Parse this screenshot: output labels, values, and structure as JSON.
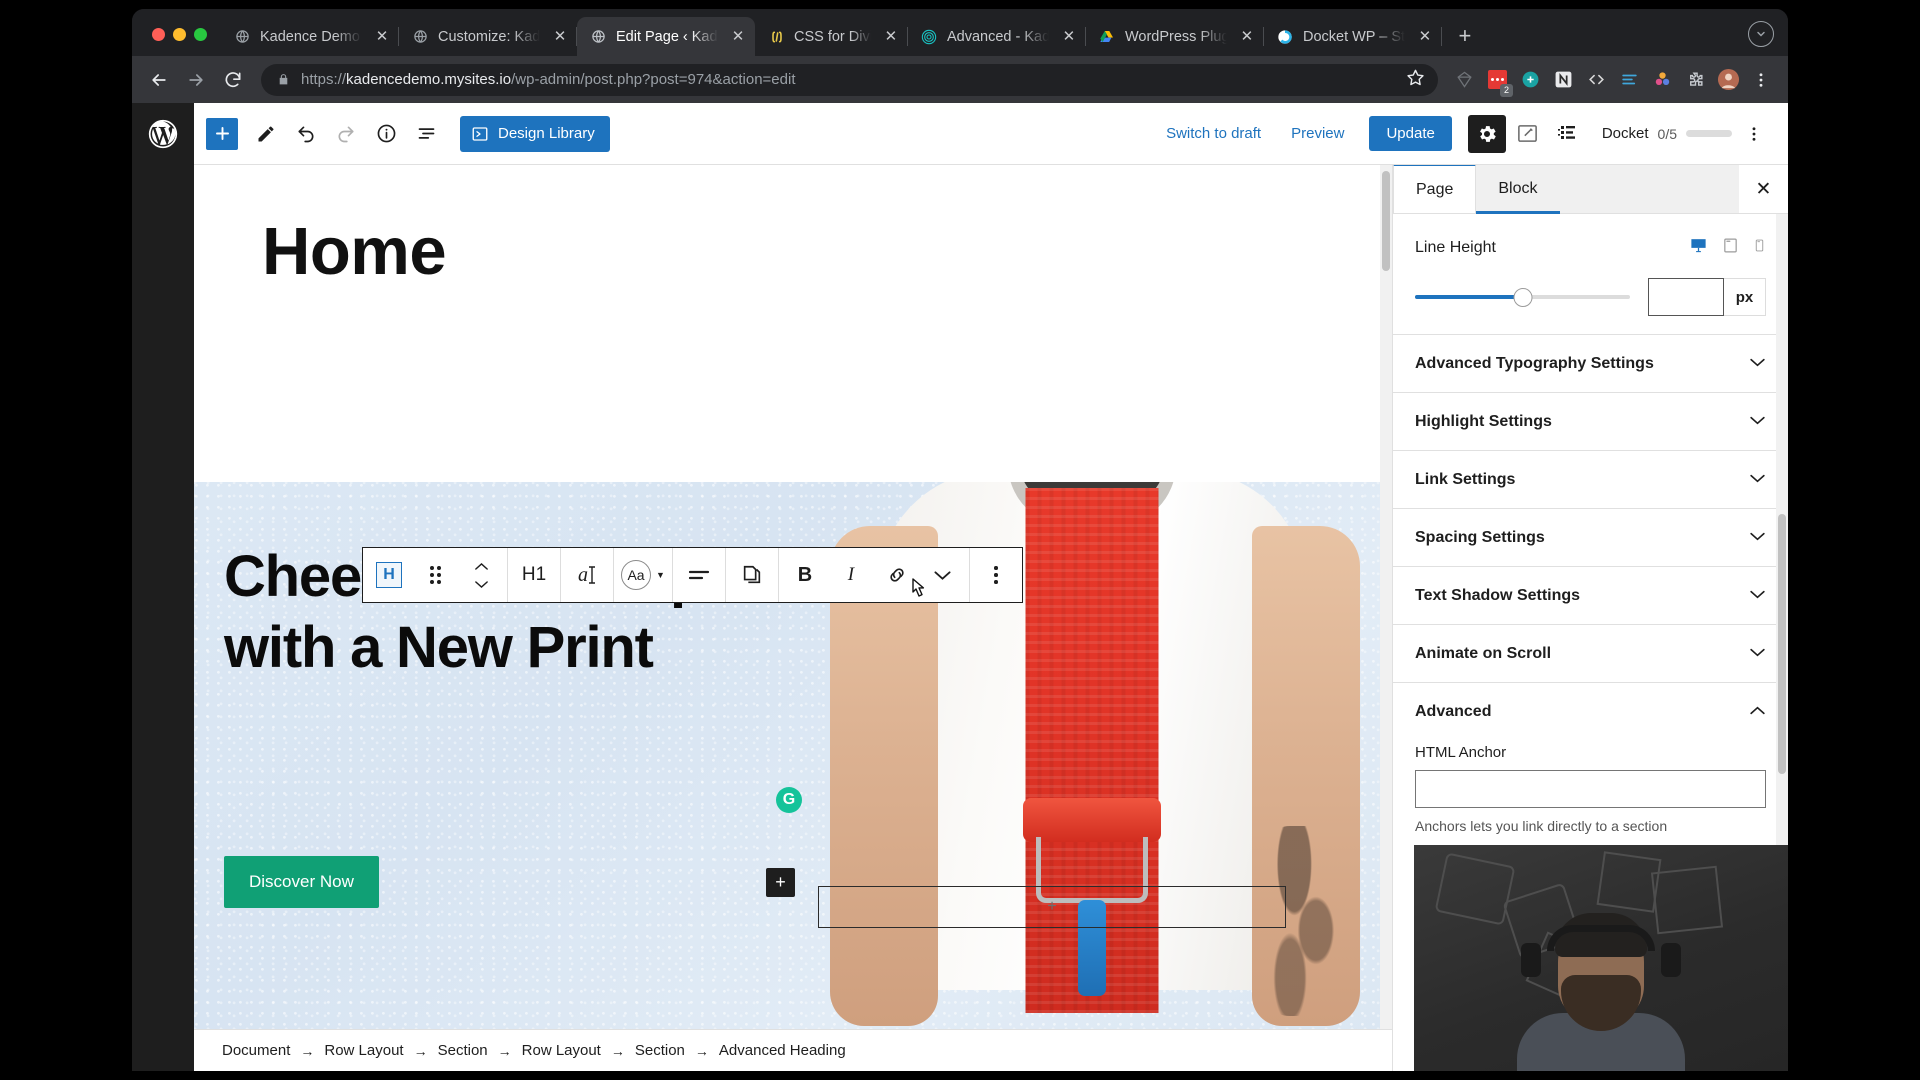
{
  "browser": {
    "tabs": [
      {
        "title": "Kadence Demo Si",
        "favicon": "globe-icon",
        "active": false
      },
      {
        "title": "Customize: Kaden",
        "favicon": "globe-icon",
        "active": false
      },
      {
        "title": "Edit Page ‹ Kaden",
        "favicon": "globe-icon",
        "active": true
      },
      {
        "title": "CSS for Divi",
        "favicon": "code-brackets-icon",
        "active": false
      },
      {
        "title": "Advanced - Kade",
        "favicon": "spiral-icon",
        "active": false
      },
      {
        "title": "WordPress Plugin",
        "favicon": "google-drive-icon",
        "active": false
      },
      {
        "title": "Docket WP – Stor",
        "favicon": "docket-icon",
        "active": false
      }
    ],
    "new_tab_label": "+",
    "close_label": "✕",
    "nav": {
      "back": "←",
      "forward": "→",
      "reload": "⟳"
    },
    "omnibox": {
      "lock_icon": "padlock-icon",
      "url_scheme": "https://",
      "url_host": "kadencedemo.mysites.io",
      "url_path": "/wp-admin/post.php?post=974&action=edit",
      "star_icon": "bookmark-star-icon"
    },
    "extensions": [
      {
        "name": "sketch-extension-icon",
        "badge": ""
      },
      {
        "name": "red-notes-extension-icon",
        "badge": "2"
      },
      {
        "name": "teal-circle-extension-icon",
        "badge": ""
      },
      {
        "name": "n-extension-icon",
        "badge": ""
      },
      {
        "name": "code-extension-icon",
        "badge": ""
      },
      {
        "name": "lines-extension-icon",
        "badge": ""
      },
      {
        "name": "colorful-flower-extension-icon",
        "badge": ""
      },
      {
        "name": "puzzle-extensions-icon",
        "badge": ""
      }
    ],
    "profile_icon": "user-avatar",
    "menu_icon": "three-dot-menu-icon"
  },
  "editor": {
    "wp_logo": "wordpress-logo",
    "toolbar_left": [
      {
        "name": "add-block-button",
        "glyph": "+"
      },
      {
        "name": "edit-tool-button",
        "glyph": "pencil-icon"
      },
      {
        "name": "undo-button",
        "glyph": "undo-icon"
      },
      {
        "name": "redo-button",
        "glyph": "redo-icon"
      },
      {
        "name": "details-button",
        "glyph": "info-icon"
      },
      {
        "name": "list-view-button",
        "glyph": "list-view-icon"
      }
    ],
    "design_library_label": "Design Library",
    "switch_to_draft_label": "Switch to draft",
    "preview_label": "Preview",
    "update_label": "Update",
    "settings_icon": "gear-icon",
    "kadence_settings_icon": "edit-square-icon",
    "kadence_blocks_icon": "kadence-blocks-icon",
    "docket": {
      "label": "Docket",
      "count": "0/5"
    },
    "more_menu_icon": "three-dot-vertical-icon"
  },
  "block_toolbar": {
    "groups": [
      [
        {
          "name": "block-type-heading-button",
          "label": "H"
        },
        {
          "name": "drag-handle",
          "label": ""
        },
        {
          "name": "move-up-down-buttons",
          "label": ""
        }
      ],
      [
        {
          "name": "heading-level-button",
          "label": "H1"
        }
      ],
      [
        {
          "name": "text-style-button",
          "label": "a"
        }
      ],
      [
        {
          "name": "font-size-dropdown",
          "label": "Aa"
        }
      ],
      [
        {
          "name": "align-text-button",
          "label": ""
        }
      ],
      [
        {
          "name": "duplicate-button",
          "label": ""
        }
      ],
      [
        {
          "name": "bold-button",
          "label": "B"
        },
        {
          "name": "italic-button",
          "label": "I"
        },
        {
          "name": "link-button",
          "label": ""
        },
        {
          "name": "more-formats-chevron",
          "label": ""
        }
      ],
      [
        {
          "name": "block-options-button",
          "label": ""
        }
      ]
    ]
  },
  "canvas": {
    "page_title": "Home",
    "hero": {
      "heading": "Cheer Yourself Up with a New Print",
      "cta_label": "Discover Now",
      "cta_color": "#10a075",
      "grammarly_badge": "G",
      "appender_label": "+",
      "empty_block_placeholder": "+"
    }
  },
  "sidebar": {
    "tabs": [
      {
        "label": "Page",
        "active": true
      },
      {
        "label": "Block",
        "active": false
      }
    ],
    "close_label": "✕",
    "line_height": {
      "label": "Line Height",
      "devices": [
        {
          "name": "desktop-icon",
          "active": true
        },
        {
          "name": "tablet-icon",
          "active": false
        },
        {
          "name": "mobile-icon",
          "active": false
        }
      ],
      "value": "",
      "unit": "px",
      "slider_percent": 50
    },
    "sections": [
      {
        "label": "Advanced Typography Settings",
        "open": false
      },
      {
        "label": "Highlight Settings",
        "open": false
      },
      {
        "label": "Link Settings",
        "open": false
      },
      {
        "label": "Spacing Settings",
        "open": false
      },
      {
        "label": "Text Shadow Settings",
        "open": false
      },
      {
        "label": "Animate on Scroll",
        "open": false
      },
      {
        "label": "Advanced",
        "open": true
      }
    ],
    "advanced": {
      "html_anchor_label": "HTML Anchor",
      "html_anchor_value": "",
      "html_anchor_help": "Anchors lets you link directly to a section"
    },
    "accent_color": "#1e73be"
  },
  "breadcrumb": {
    "separator": "→",
    "items": [
      "Document",
      "Row Layout",
      "Section",
      "Row Layout",
      "Section",
      "Advanced Heading"
    ]
  }
}
